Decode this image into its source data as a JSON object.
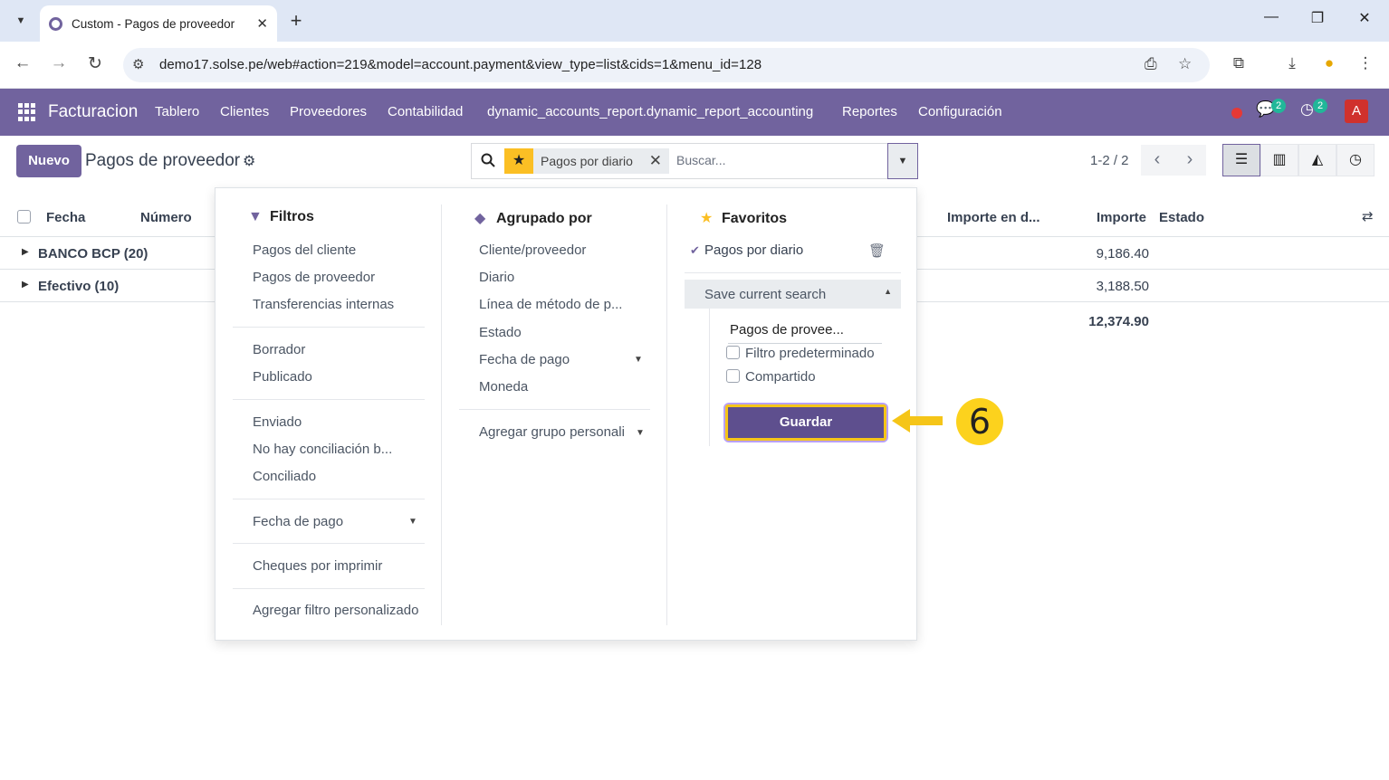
{
  "browser": {
    "tab_title": "Custom - Pagos de proveedor",
    "url": "demo17.solse.pe/web#action=219&model=account.payment&view_type=list&cids=1&menu_id=128"
  },
  "navbar": {
    "brand": "Facturacion",
    "menu": [
      "Tablero",
      "Clientes",
      "Proveedores",
      "Contabilidad",
      "dynamic_accounts_report.dynamic_report_accounting",
      "Reportes",
      "Configuración"
    ],
    "messages_badge": "2",
    "activities_badge": "2",
    "avatar_letter": "A"
  },
  "control": {
    "new_label": "Nuevo",
    "page_title": "Pagos de proveedor",
    "facet_label": "Pagos por diario",
    "search_placeholder": "Buscar...",
    "pager": "1-2 / 2"
  },
  "list": {
    "headers": {
      "fecha": "Fecha",
      "numero": "Número",
      "importe_divisa": "Importe en d...",
      "importe": "Importe",
      "estado": "Estado"
    },
    "groups": [
      {
        "name": "BANCO BCP (20)",
        "amount": "9,186.40"
      },
      {
        "name": "Efectivo (10)",
        "amount": "3,188.50"
      }
    ],
    "total": "12,374.90"
  },
  "panel": {
    "filters_title": "Filtros",
    "filters": {
      "group1": [
        "Pagos del cliente",
        "Pagos de proveedor",
        "Transferencias internas"
      ],
      "group2": [
        "Borrador",
        "Publicado"
      ],
      "group3": [
        "Enviado",
        "No hay conciliación b...",
        "Conciliado"
      ],
      "date": "Fecha de pago",
      "cheques": "Cheques por imprimir",
      "custom": "Agregar filtro personalizado"
    },
    "groupby_title": "Agrupado por",
    "groupby": [
      "Cliente/proveedor",
      "Diario",
      "Línea de método de p...",
      "Estado",
      "Fecha de pago",
      "Moneda"
    ],
    "groupby_custom": "Agregar grupo personali",
    "favorites_title": "Favoritos",
    "favorite_item": "Pagos por diario",
    "save_current": "Save current search",
    "save_name_value": "Pagos de provee...",
    "default_filter": "Filtro predeterminado",
    "shared": "Compartido",
    "save_button": "Guardar"
  },
  "annotation": {
    "step": "6"
  },
  "colors": {
    "primary": "#71639e",
    "highlight": "#f5c518",
    "star": "#fbbf24"
  }
}
